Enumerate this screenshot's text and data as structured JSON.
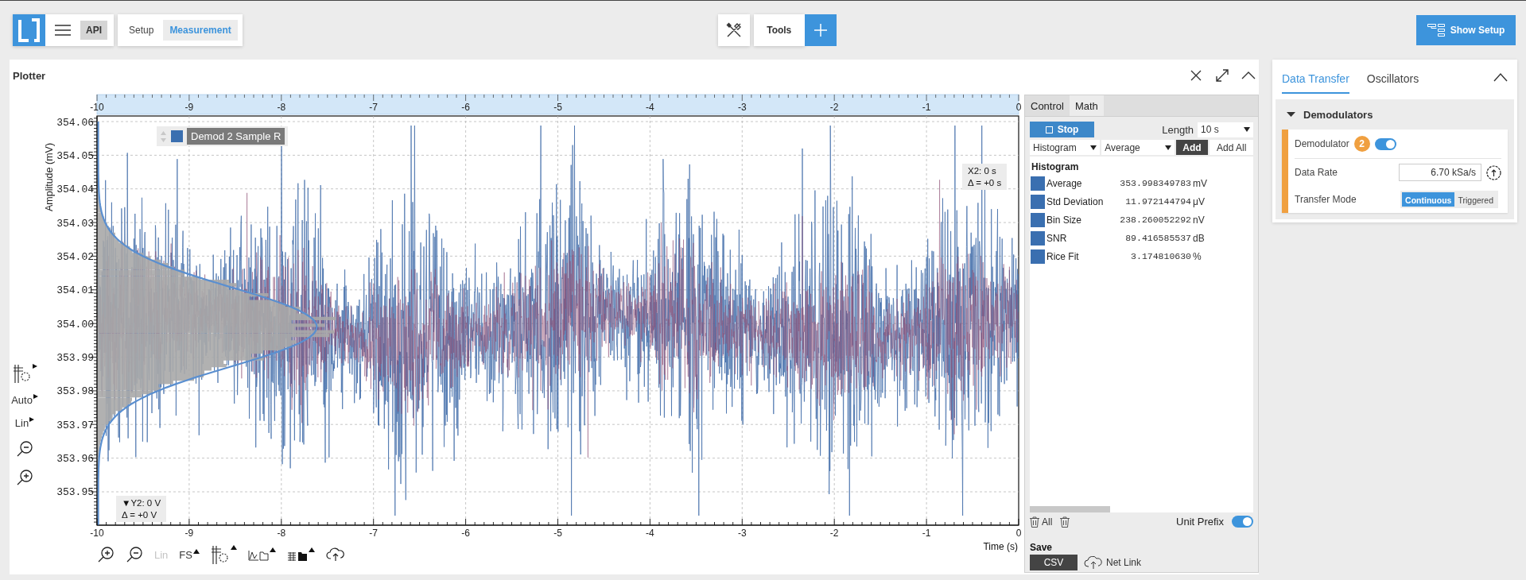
{
  "top_bar": {
    "api_button": "API",
    "nav_tabs": [
      {
        "label": "Setup",
        "selected": false
      },
      {
        "label": "Measurement",
        "selected": true
      }
    ],
    "tools_button": "Tools",
    "show_setup_button": "Show Setup"
  },
  "plotter": {
    "title": "Plotter",
    "side_tools": [
      {
        "kind": "grid",
        "menu": true
      },
      {
        "kind": "text",
        "label": "Auto",
        "disabled": false,
        "menu": true
      },
      {
        "kind": "text",
        "label": "Lin",
        "disabled": false,
        "menu": true
      },
      {
        "kind": "zoom_out",
        "menu": false
      },
      {
        "kind": "zoom_in",
        "menu": false
      }
    ],
    "x_axis_top": {
      "ticks": [
        "-10",
        "-9",
        "-8",
        "-7",
        "-6",
        "-5",
        "-4",
        "-3",
        "-2",
        "-1",
        "0"
      ]
    },
    "y_axis": {
      "label": "Amplitude (mV)",
      "ticks": [
        "354.06",
        "354.05",
        "354.04",
        "354.03",
        "354.02",
        "354.01",
        "354.00",
        "353.99",
        "353.98",
        "353.97",
        "353.96",
        "353.95"
      ]
    },
    "x_axis_bottom": {
      "label": "Time (s)",
      "ticks": [
        "-10",
        "-9",
        "-8",
        "-7",
        "-6",
        "-5",
        "-4",
        "-3",
        "-2",
        "-1",
        "0"
      ]
    },
    "legend": {
      "label": "Demod 2 Sample R"
    },
    "x_cursor": {
      "label": "X2: 0 s",
      "delta": "Δ = +0 s"
    },
    "y_cursor": {
      "label": "▼Y2: 0 V",
      "delta": "Δ = +0 V"
    },
    "bottom_tools": [
      {
        "kind": "zoom_in",
        "menu": false
      },
      {
        "kind": "zoom_out",
        "menu": false
      },
      {
        "kind": "text",
        "label": "Lin",
        "disabled": true,
        "menu": false
      },
      {
        "kind": "text",
        "label": "FS",
        "disabled": false,
        "menu": true
      },
      {
        "kind": "grid",
        "menu": true
      },
      {
        "kind": "chart_folder",
        "menu": true
      },
      {
        "kind": "table_folder",
        "menu": true
      },
      {
        "kind": "cloud",
        "menu": false
      }
    ]
  },
  "math_panel": {
    "tabs": [
      {
        "label": "Control",
        "selected": false
      },
      {
        "label": "Math",
        "selected": true
      }
    ],
    "stop_button": "Stop",
    "length_label": "Length",
    "length_value": "10 s",
    "function_select": "Histogram",
    "operation_select": "Average",
    "add_button": "Add",
    "add_all_button": "Add All",
    "results_title": "Histogram",
    "results": [
      {
        "name": "Average",
        "value": "353.998349783",
        "unit": "mV"
      },
      {
        "name": "Std Deviation",
        "value": "11.972144794",
        "unit": "μV"
      },
      {
        "name": "Bin Size",
        "value": "238.260052292",
        "unit": "nV"
      },
      {
        "name": "SNR",
        "value": "89.416585537",
        "unit": "dB"
      },
      {
        "name": "Rice Fit",
        "value": "3.174810630",
        "unit": "%"
      }
    ],
    "delete_all_button": "All",
    "unit_prefix": {
      "label": "Unit Prefix",
      "on": true
    },
    "save_title": "Save",
    "csv_button": "CSV",
    "net_link": "Net Link"
  },
  "settings_panel": {
    "tabs": [
      {
        "label": "Data Transfer",
        "selected": true
      },
      {
        "label": "Oscillators",
        "selected": false
      }
    ],
    "section": {
      "title": "Demodulators",
      "expanded": true
    },
    "demodulator": {
      "label": "Demodulator",
      "badge": "2",
      "enabled": true
    },
    "data_rate": {
      "label": "Data Rate",
      "value": "6.70 kSa/s"
    },
    "transfer_mode": {
      "label": "Transfer Mode",
      "options": [
        {
          "label": "Continuous",
          "selected": true
        },
        {
          "label": "Triggered",
          "selected": false
        }
      ]
    }
  }
}
